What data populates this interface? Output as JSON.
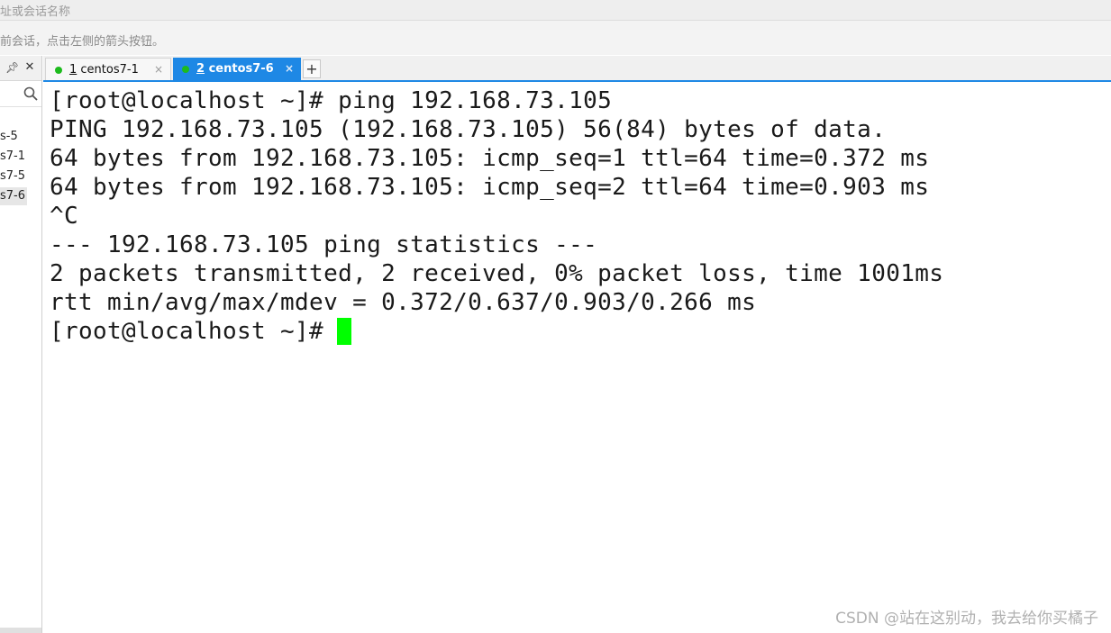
{
  "address_bar": {
    "hint": "址或会话名称"
  },
  "info_bar": {
    "text": "前会话，点击左侧的箭头按钮。"
  },
  "sidebar": {
    "pin_icon": "pin-icon",
    "close_icon": "close-icon",
    "search_icon": "search-icon",
    "sessions": [
      {
        "label": "s-5"
      },
      {
        "label": "s7-1"
      },
      {
        "label": "s7-5"
      },
      {
        "label": "s7-6",
        "selected": true
      }
    ]
  },
  "tabs": [
    {
      "number": "1",
      "name": " centos7-1",
      "active": false,
      "status_color": "#1dbb1d"
    },
    {
      "number": "2",
      "name": " centos7-6",
      "active": true,
      "status_color": "#1dbb1d"
    }
  ],
  "add_tab_label": "+",
  "tab_close_glyph": "×",
  "terminal": {
    "lines": [
      "[root@localhost ~]# ping 192.168.73.105",
      "PING 192.168.73.105 (192.168.73.105) 56(84) bytes of data.",
      "64 bytes from 192.168.73.105: icmp_seq=1 ttl=64 time=0.372 ms",
      "64 bytes from 192.168.73.105: icmp_seq=2 ttl=64 time=0.903 ms",
      "^C",
      "--- 192.168.73.105 ping statistics ---",
      "2 packets transmitted, 2 received, 0% packet loss, time 1001ms",
      "rtt min/avg/max/mdev = 0.372/0.637/0.903/0.266 ms",
      "[root@localhost ~]# "
    ],
    "cursor_color": "#00ff00"
  },
  "watermark": "CSDN @站在这别动，我去给你买橘子",
  "colors": {
    "accent": "#1e88e5",
    "status": "#1dbb1d"
  }
}
